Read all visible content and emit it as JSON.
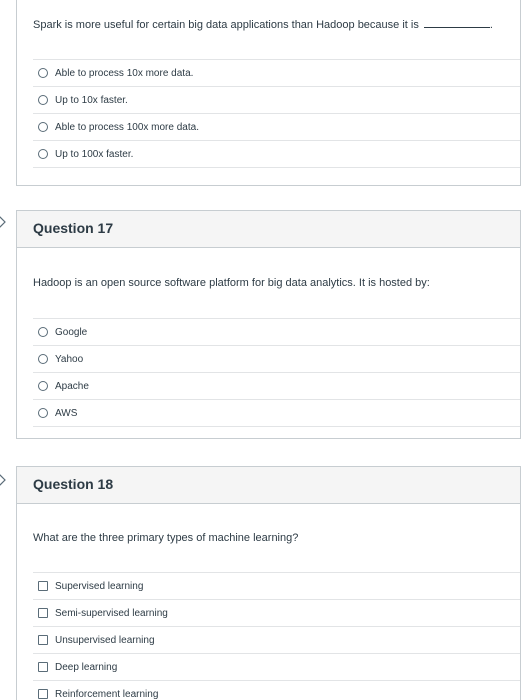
{
  "q16": {
    "text": "Spark is more useful for certain big data applications than Hadoop because it is",
    "answers": [
      "Able to process 10x more data.",
      "Up to 10x faster.",
      "Able to process 100x more data.",
      "Up to 100x faster."
    ]
  },
  "q17": {
    "title": "Question 17",
    "text": "Hadoop is an open source software platform for big data analytics. It is hosted by:",
    "answers": [
      "Google",
      "Yahoo",
      "Apache",
      "AWS"
    ]
  },
  "q18": {
    "title": "Question 18",
    "text": "What are the three primary types of machine learning?",
    "answers": [
      "Supervised learning",
      "Semi-supervised learning",
      "Unsupervised learning",
      "Deep learning",
      "Reinforcement learning"
    ]
  }
}
